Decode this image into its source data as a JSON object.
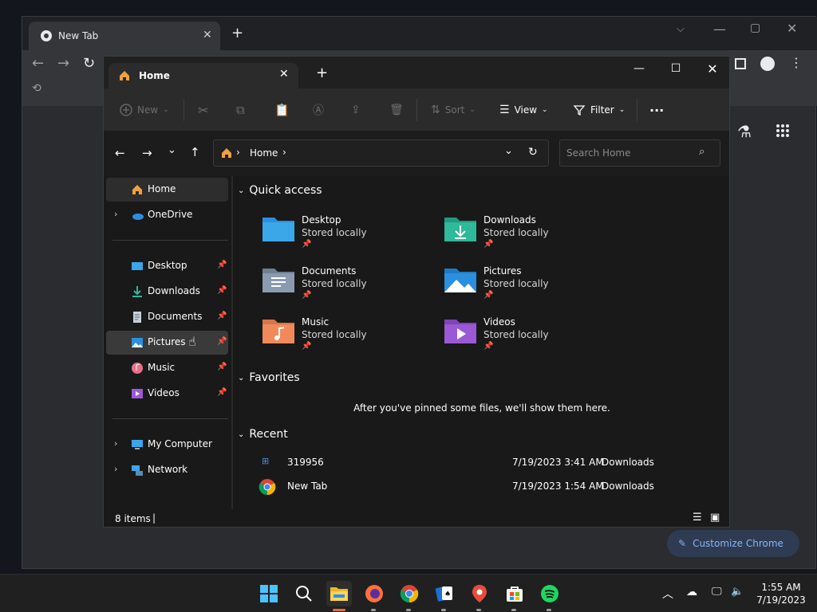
{
  "chrome": {
    "tab_title": "New Tab",
    "customize_label": "Customize Chrome"
  },
  "explorer": {
    "tab_title": "Home",
    "toolbar": {
      "new_label": "New",
      "sort_label": "Sort",
      "view_label": "View",
      "filter_label": "Filter"
    },
    "address": {
      "location": "Home",
      "search_placeholder": "Search Home"
    },
    "sidebar": {
      "top": [
        {
          "label": "Home",
          "icon": "home-icon"
        },
        {
          "label": "OneDrive",
          "icon": "onedrive-icon"
        }
      ],
      "pinned": [
        {
          "label": "Desktop",
          "icon": "desktop-folder-icon"
        },
        {
          "label": "Downloads",
          "icon": "downloads-folder-icon"
        },
        {
          "label": "Documents",
          "icon": "documents-folder-icon"
        },
        {
          "label": "Pictures",
          "icon": "pictures-folder-icon"
        },
        {
          "label": "Music",
          "icon": "music-folder-icon"
        },
        {
          "label": "Videos",
          "icon": "videos-folder-icon"
        }
      ],
      "bottom": [
        {
          "label": "My Computer",
          "icon": "computer-icon"
        },
        {
          "label": "Network",
          "icon": "network-icon"
        }
      ]
    },
    "quick_access": {
      "heading": "Quick access",
      "items": [
        {
          "name": "Desktop",
          "sub": "Stored locally",
          "color": "#3ba7e8"
        },
        {
          "name": "Downloads",
          "sub": "Stored locally",
          "color": "#2fb89a"
        },
        {
          "name": "Documents",
          "sub": "Stored locally",
          "color": "#8a9bb0"
        },
        {
          "name": "Pictures",
          "sub": "Stored locally",
          "color": "#2b8fe0"
        },
        {
          "name": "Music",
          "sub": "Stored locally",
          "color": "#f08a5d"
        },
        {
          "name": "Videos",
          "sub": "Stored locally",
          "color": "#9b59d6"
        }
      ]
    },
    "favorites": {
      "heading": "Favorites",
      "empty_text": "After you've pinned some files, we'll show them here."
    },
    "recent": {
      "heading": "Recent",
      "items": [
        {
          "name": "319956",
          "date": "7/19/2023 3:41 AM",
          "location": "Downloads"
        },
        {
          "name": "New Tab",
          "date": "7/19/2023 1:54 AM",
          "location": "Downloads"
        }
      ]
    },
    "status": {
      "items_count": "8 items"
    }
  },
  "taskbar": {
    "time": "1:55 AM",
    "date": "7/19/2023"
  }
}
